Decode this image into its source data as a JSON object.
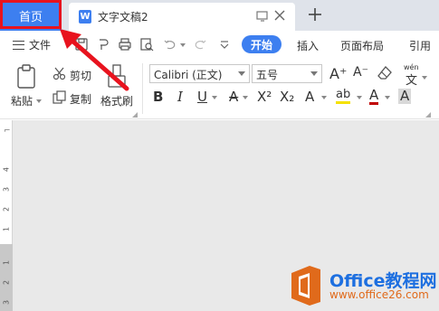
{
  "tabs": {
    "home": "首页",
    "document": "文字文稿2",
    "doc_icon_letter": "W"
  },
  "menu": {
    "file": "文件",
    "items": [
      "开始",
      "插入",
      "页面布局",
      "引用"
    ]
  },
  "ribbon": {
    "paste": "粘贴",
    "cut": "剪切",
    "copy": "复制",
    "format_painter": "格式刷",
    "font_name": "Calibri (正文)",
    "font_size": "五号",
    "pinyin": "wén"
  },
  "ruler": {
    "top_numbers": [
      "4",
      "3",
      "2",
      "1"
    ],
    "bottom_numbers": [
      "1",
      "2",
      "3"
    ]
  },
  "watermark": {
    "brand": "Office教程网",
    "url": "www.office26.com"
  },
  "colors": {
    "accent": "#3d7ff0",
    "highlight_box": "#e8131e",
    "arrow": "#e8131e",
    "logo_orange": "#e06a1b",
    "logo_blue": "#1d6fe0"
  }
}
